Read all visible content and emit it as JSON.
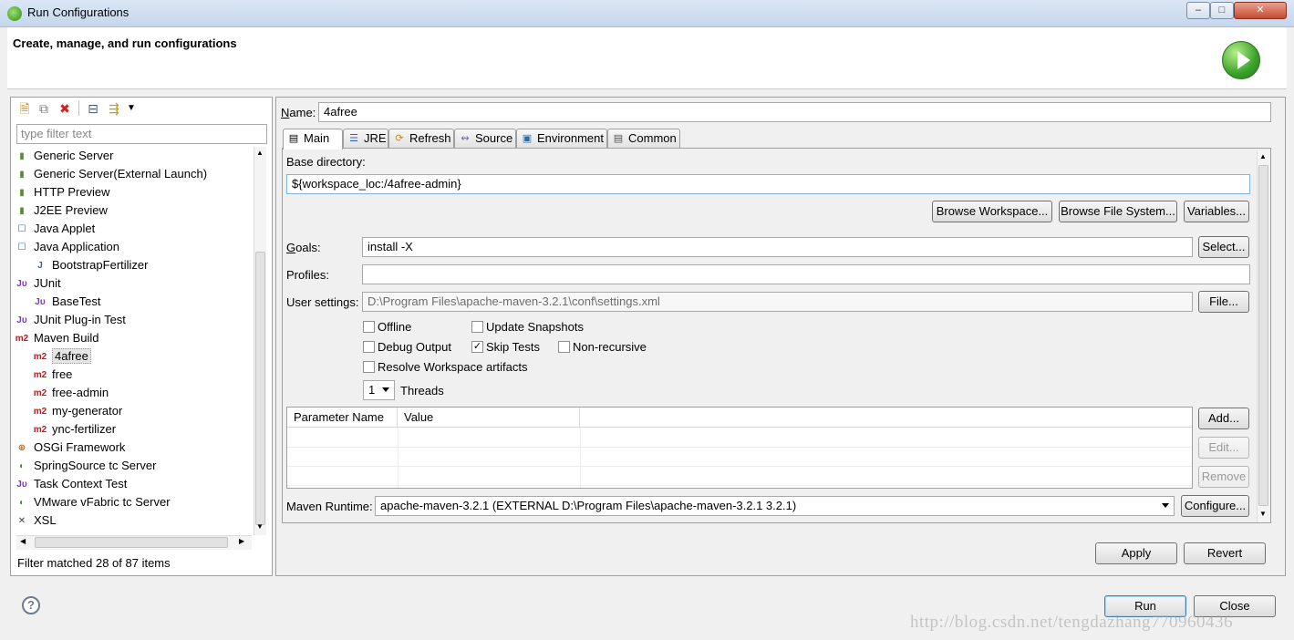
{
  "window": {
    "title": "Run Configurations",
    "controls": [
      "–",
      "□",
      "✕"
    ]
  },
  "header": {
    "title": "Create, manage, and run configurations"
  },
  "left": {
    "toolbar": [
      "new-config-icon",
      "duplicate-icon",
      "delete-icon",
      "collapse-all-icon",
      "filter-icon"
    ],
    "filter_placeholder": "type filter text",
    "tree": [
      {
        "label": "Generic Server",
        "icon": "server-icon",
        "indent": 0
      },
      {
        "label": "Generic Server(External Launch)",
        "icon": "server-icon",
        "indent": 0
      },
      {
        "label": "HTTP Preview",
        "icon": "server-icon",
        "indent": 0
      },
      {
        "label": "J2EE Preview",
        "icon": "server-icon",
        "indent": 0
      },
      {
        "label": "Java Applet",
        "icon": "applet-icon",
        "indent": 0
      },
      {
        "label": "Java Application",
        "icon": "java-app-icon",
        "indent": 0
      },
      {
        "label": "BootstrapFertilizer",
        "icon": "java-file-icon",
        "indent": 1
      },
      {
        "label": "JUnit",
        "icon": "junit-icon",
        "indent": 0
      },
      {
        "label": "BaseTest",
        "icon": "junit-icon",
        "indent": 1
      },
      {
        "label": "JUnit Plug-in Test",
        "icon": "junit-plugin-icon",
        "indent": 0
      },
      {
        "label": "Maven Build",
        "icon": "maven-icon",
        "indent": 0
      },
      {
        "label": "4afree",
        "icon": "maven-icon",
        "indent": 1,
        "selected": true
      },
      {
        "label": "free",
        "icon": "maven-icon",
        "indent": 1
      },
      {
        "label": "free-admin",
        "icon": "maven-icon",
        "indent": 1
      },
      {
        "label": "my-generator",
        "icon": "maven-icon",
        "indent": 1
      },
      {
        "label": "ync-fertilizer",
        "icon": "maven-icon",
        "indent": 1
      },
      {
        "label": "OSGi Framework",
        "icon": "osgi-icon",
        "indent": 0
      },
      {
        "label": "SpringSource tc Server",
        "icon": "spring-icon",
        "indent": 0
      },
      {
        "label": "Task Context Test",
        "icon": "junit-icon",
        "indent": 0
      },
      {
        "label": "VMware vFabric tc Server",
        "icon": "spring-icon",
        "indent": 0
      },
      {
        "label": "XSL",
        "icon": "xsl-icon",
        "indent": 0
      }
    ],
    "status": "Filter matched 28 of 87 items"
  },
  "config": {
    "name_label": "Name:",
    "name_value": "4afree",
    "tabs": [
      {
        "label": "Main",
        "icon": "main-tab-icon"
      },
      {
        "label": "JRE",
        "icon": "jre-icon"
      },
      {
        "label": "Refresh",
        "icon": "refresh-icon"
      },
      {
        "label": "Source",
        "icon": "source-icon"
      },
      {
        "label": "Environment",
        "icon": "environment-icon"
      },
      {
        "label": "Common",
        "icon": "common-icon"
      }
    ],
    "base_dir_label": "Base directory:",
    "base_dir_value": "${workspace_loc:/4afree-admin}",
    "browse_workspace": "Browse Workspace...",
    "browse_fs": "Browse File System...",
    "variables": "Variables...",
    "goals_label": "Goals:",
    "goals_value": "install -X",
    "select_btn": "Select...",
    "profiles_label": "Profiles:",
    "profiles_value": "",
    "user_settings_label": "User settings:",
    "user_settings_value": "D:\\Program Files\\apache-maven-3.2.1\\conf\\settings.xml",
    "file_btn": "File...",
    "checkboxes": {
      "offline": {
        "label": "Offline",
        "checked": false
      },
      "update_snapshots": {
        "label": "Update Snapshots",
        "checked": false
      },
      "debug_output": {
        "label": "Debug Output",
        "checked": false
      },
      "skip_tests": {
        "label": "Skip Tests",
        "checked": true
      },
      "non_recursive": {
        "label": "Non-recursive",
        "checked": false
      },
      "resolve_workspace": {
        "label": "Resolve Workspace artifacts",
        "checked": false
      }
    },
    "threads_value": "1",
    "threads_label": "Threads",
    "table": {
      "columns": [
        "Parameter Name",
        "Value"
      ],
      "rows": []
    },
    "add_btn": "Add...",
    "edit_btn": "Edit...",
    "remove_btn": "Remove",
    "runtime_label": "Maven Runtime:",
    "runtime_value": "apache-maven-3.2.1 (EXTERNAL D:\\Program Files\\apache-maven-3.2.1 3.2.1)",
    "configure_btn": "Configure...",
    "apply_btn": "Apply",
    "revert_btn": "Revert"
  },
  "footer": {
    "run_btn": "Run",
    "close_btn": "Close",
    "watermark": "http://blog.csdn.net/tengdazhang770960436"
  }
}
